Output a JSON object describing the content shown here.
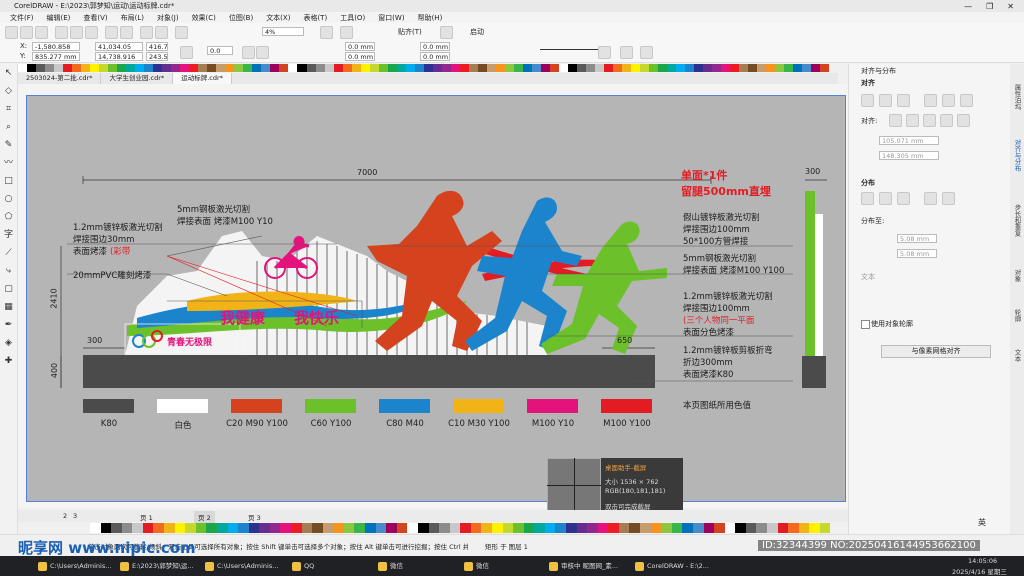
{
  "window": {
    "title": "CorelDRAW - E:\\2023\\郭梦知\\运动\\运动标牌.cdr*",
    "controls": [
      "—",
      "❐",
      "✕"
    ]
  },
  "menu": [
    "文件(F)",
    "编辑(E)",
    "查看(V)",
    "布局(L)",
    "对象(J)",
    "效果(C)",
    "位图(B)",
    "文本(X)",
    "表格(T)",
    "工具(O)",
    "窗口(W)",
    "帮助(H)"
  ],
  "toolbar": {
    "zoom": "4%",
    "snap_label": "贴齐(T)",
    "launch_label": "启动"
  },
  "propbar": {
    "x": "-1,580.858 mm",
    "y": "835.277 mm",
    "w": "41,034.05 mm",
    "h": "14,738.916 mm",
    "sx": "416.7",
    "sy": "243.5",
    "rotation": "0.0",
    "pos1": "0.0 mm",
    "pos2": "0.0 mm",
    "pos3": "0.0 mm",
    "pos4": "0.0 mm"
  },
  "doc_tabs": [
    "2503024-第二批.cdr*",
    "大学生创业园.cdr*",
    "运动标牌.cdr*"
  ],
  "design": {
    "dim_total": "7000",
    "dim_height": "2410",
    "dim_base": "400",
    "dim_left": "300",
    "dim_right": "650",
    "dim_side": "300",
    "headline1": "单面*1件",
    "headline2": "留腿500mm直埋",
    "slogan1": "我健康",
    "slogan2": "我快乐",
    "slogan3": "青春无极限",
    "notes": {
      "n1a": "1.2mm镀锌板激光切割",
      "n1b": "焊接围边30mm",
      "n1c": "表面烤漆",
      "n1d": "(彩带",
      "n2a": "5mm钢板激光切割",
      "n2b": "焊接表面 烤漆M100 Y10",
      "n3": "20mmPVC雕刻烤漆",
      "n4a": "假山镀锌板激光切割",
      "n4b": "焊接围边100mm",
      "n4c": "50*100方管焊接",
      "n5a": "5mm钢板激光切割",
      "n5b": "焊接表面 烤漆M100 Y100",
      "n6a": "1.2mm镀锌板激光切割",
      "n6b": "焊接围边100mm",
      "n6c": "(三个人物同一平面",
      "n6d": "表面分色烤漆",
      "n7a": "1.2mm镀锌板剪板折弯",
      "n7b": "折边300mm",
      "n7c": "表面烤漆K80"
    },
    "swatches": [
      {
        "label": "K80",
        "color": "#4b4b4b"
      },
      {
        "label": "白色",
        "color": "#ffffff"
      },
      {
        "label": "C20 M90 Y100",
        "color": "#d4421e"
      },
      {
        "label": "C60 Y100",
        "color": "#6cc12a"
      },
      {
        "label": "C80 M40",
        "color": "#1c84cc"
      },
      {
        "label": "C10 M30 Y100",
        "color": "#f2b317"
      },
      {
        "label": "M100 Y10",
        "color": "#e4137b"
      },
      {
        "label": "M100 Y100",
        "color": "#e31b23"
      }
    ],
    "swatch_caption": "本页图纸所用色值"
  },
  "right_panel": {
    "header": "对齐与分布",
    "align_title": "对齐",
    "align_to": "对齐:",
    "val1": "105.071 mm",
    "val2": "148.305 mm",
    "distribute_title": "分布",
    "distribute_to": "分布至:",
    "val3": "5.08 mm",
    "val4": "5.08 mm",
    "text_label": "文本",
    "outline_label": "使用对象轮廓",
    "grid_button": "与像素网格对齐",
    "tabs": [
      "属性泊坞",
      "对齐与分布",
      "步长和重复",
      "对象",
      "轮廓",
      "文本"
    ]
  },
  "page_tabs": [
    "2",
    "3",
    "页 1",
    "页 2",
    "页 3"
  ],
  "popup": {
    "title": "桌面助手-截屏",
    "size": "大小 1536 × 762",
    "rgb": "RGB(180,181,181)",
    "hint": "双击可完成截屏"
  },
  "status": {
    "text": "单击对象两次可旋转/倾斜；双击工具可选择所有对象；按住 Shift 键单击可选择多个对象；按住 Alt 键单击可进行挖掘；按住 Ctrl 并单击可在组中选择",
    "layer": "矩形 于 图层 1",
    "lang": "英",
    "watermark_left": "昵享网 www.nipic.com",
    "watermark_right": "ID:32344399 NO:20250416144953662100"
  },
  "taskbar": {
    "items": [
      "C:\\Users\\Adminis...",
      "E:\\2023\\郭梦知\\运...",
      "C:\\Users\\Adminis...",
      "QQ",
      "微信",
      "微信",
      "审核中 昵图网_素...",
      "CorelDRAW - E:\\2..."
    ],
    "time": "14:05:06",
    "date": "2025/4/16 星期三"
  },
  "colors": {
    "accent": "#5a7fd6",
    "page_bg": "#b5b5b5",
    "orange": "#d4421e",
    "green": "#6cc12a",
    "blue": "#1c84cc",
    "red": "#e31b23",
    "magenta": "#e4137b"
  }
}
